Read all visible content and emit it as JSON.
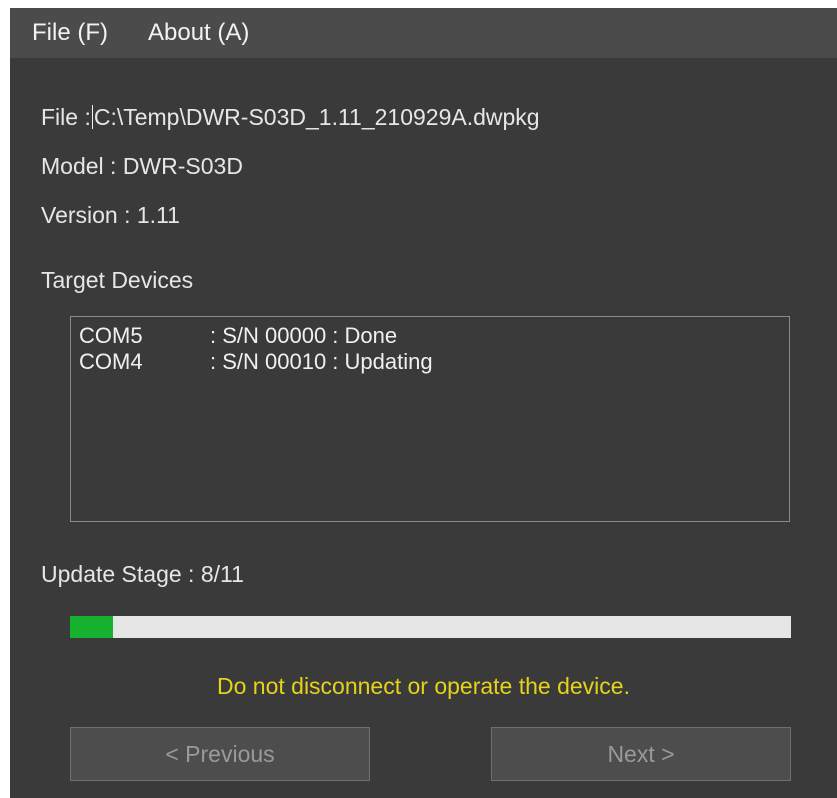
{
  "menubar": {
    "file": "File (F)",
    "about": "About (A)"
  },
  "info": {
    "file_label": "File :",
    "file_value": "C:\\Temp\\DWR-S03D_1.11_210929A.dwpkg",
    "model": "Model : DWR-S03D",
    "version": "Version :  1.11"
  },
  "target_devices": {
    "heading": "Target Devices",
    "devices": [
      {
        "port": "COM5",
        "info": ": S/N 00000 : Done"
      },
      {
        "port": "COM4",
        "info": ": S/N 00010 : Updating"
      }
    ]
  },
  "update": {
    "stage": "Update Stage : 8/11",
    "progress_fraction": 0.06,
    "warning": "Do not disconnect or operate the device."
  },
  "buttons": {
    "previous": "< Previous",
    "next": "Next  >"
  },
  "colors": {
    "background": "#3a3a3a",
    "menubar": "#4b4b4b",
    "progress_fill": "#16b12f",
    "warning_text": "#e6d21a"
  }
}
